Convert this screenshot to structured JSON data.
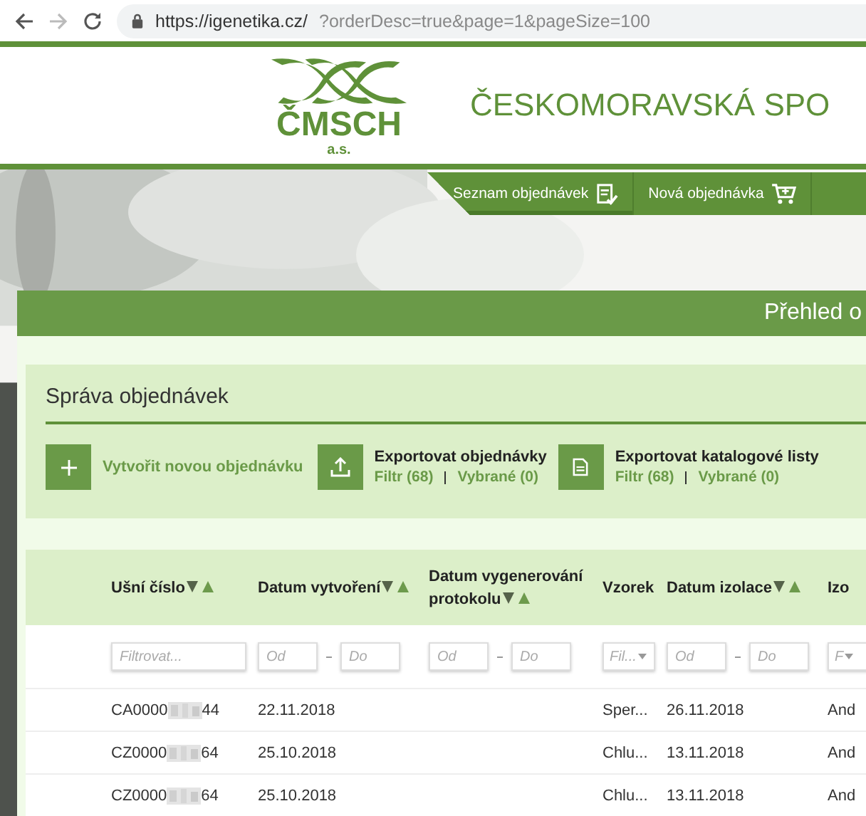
{
  "browser": {
    "url_host": "https://igenetika.cz/",
    "url_path": "?orderDesc=true&page=1&pageSize=100"
  },
  "header": {
    "logo_text": "ČMSCH",
    "logo_sub": "a.s.",
    "title": "ČESKOMORAVSKÁ SPO"
  },
  "nav_tabs": [
    {
      "label": "Seznam objednávek",
      "selected": true
    },
    {
      "label": "Nová objednávka",
      "selected": false
    }
  ],
  "panel": {
    "title": "Přehled o"
  },
  "management": {
    "title": "Správa objednávek",
    "actions": [
      {
        "kind": "create",
        "label": "Vytvořit novou objednávku"
      },
      {
        "kind": "export",
        "label": "Exportovat objednávky",
        "links": [
          "Filtr (68)",
          "Vybrané (0)"
        ]
      },
      {
        "kind": "catalog",
        "label": "Exportovat katalogové listy",
        "links": [
          "Filtr (68)",
          "Vybrané (0)"
        ]
      }
    ]
  },
  "table": {
    "columns": [
      {
        "label": "Ušní číslo",
        "sortable": true,
        "filter": {
          "kind": "text",
          "fields": [
            {
              "placeholder": "Filtrovat..."
            }
          ]
        }
      },
      {
        "label": "Datum vytvoření",
        "sortable": true,
        "filter": {
          "kind": "range",
          "fields": [
            {
              "placeholder": "Od"
            },
            {
              "placeholder": "Do"
            }
          ]
        }
      },
      {
        "label": "Datum vygenerování protokolu",
        "sortable": true,
        "filter": {
          "kind": "range",
          "fields": [
            {
              "placeholder": "Od"
            },
            {
              "placeholder": "Do"
            }
          ]
        }
      },
      {
        "label": "Vzorek",
        "sortable": false,
        "filter": {
          "kind": "select",
          "fields": [
            {
              "placeholder": "Fil..."
            }
          ]
        }
      },
      {
        "label": "Datum izolace",
        "sortable": true,
        "filter": {
          "kind": "range",
          "fields": [
            {
              "placeholder": "Od"
            },
            {
              "placeholder": "Do"
            }
          ]
        }
      },
      {
        "label": "Izo",
        "sortable": false,
        "filter": {
          "kind": "select",
          "fields": [
            {
              "placeholder": "F"
            }
          ]
        }
      }
    ],
    "rows": [
      {
        "ear_suffix": "44",
        "cells": [
          "CA0000",
          "22.11.2018",
          "",
          "Sper...",
          "26.11.2018",
          "And"
        ]
      },
      {
        "ear_suffix": "64",
        "cells": [
          "CZ0000",
          "25.10.2018",
          "",
          "Chlu...",
          "13.11.2018",
          "And"
        ]
      },
      {
        "ear_suffix": "64",
        "cells": [
          "CZ0000",
          "25.10.2018",
          "",
          "Chlu...",
          "13.11.2018",
          "And"
        ]
      }
    ]
  }
}
